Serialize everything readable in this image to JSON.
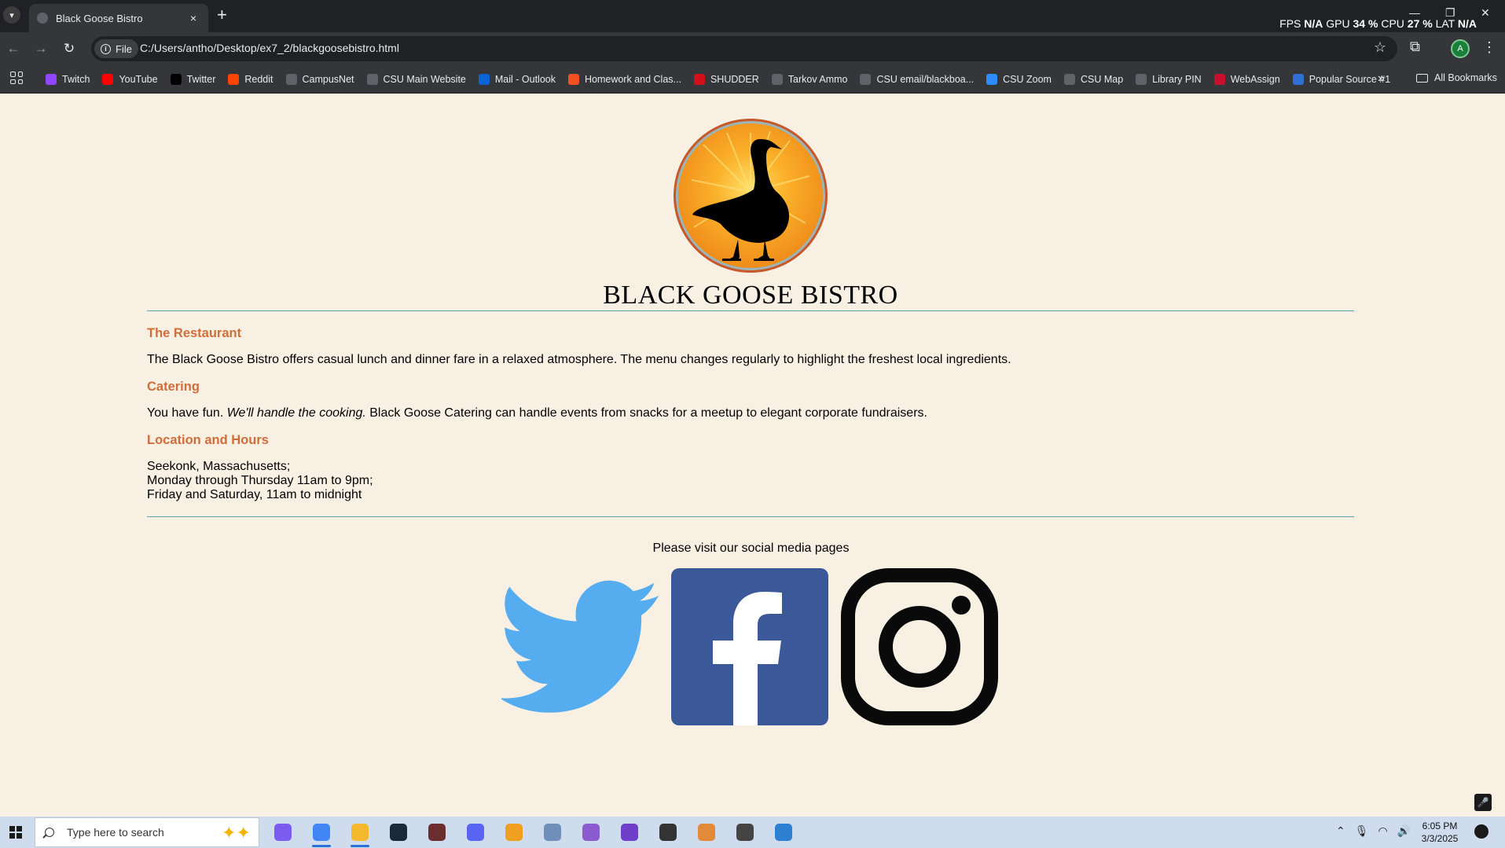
{
  "browser": {
    "tab_title": "Black Goose Bistro",
    "new_tab": "+",
    "tab_close": "×",
    "overlay": {
      "fps_label": "FPS",
      "fps_value": "N/A",
      "gpu_label": "GPU",
      "gpu_value": "34 %",
      "cpu_label": "CPU",
      "cpu_value": "27 %",
      "lat_label": "LAT",
      "lat_value": "N/A"
    },
    "chip_label": "File",
    "url": "C:/Users/antho/Desktop/ex7_2/blackgoosebistro.html",
    "profile_initial": "A",
    "bookmarks": [
      {
        "label": "Twitch",
        "icon": "twitch-icon",
        "color": "#9146ff"
      },
      {
        "label": "YouTube",
        "icon": "youtube-icon",
        "color": "#ff0000"
      },
      {
        "label": "Twitter",
        "icon": "x-icon",
        "color": "#000000"
      },
      {
        "label": "Reddit",
        "icon": "reddit-icon",
        "color": "#ff4500"
      },
      {
        "label": "CampusNet",
        "icon": "globe-icon",
        "color": "#5f6368"
      },
      {
        "label": "CSU Main Website",
        "icon": "csu-icon",
        "color": "#5f6368"
      },
      {
        "label": "Mail - Outlook",
        "icon": "outlook-icon",
        "color": "#0a64d6"
      },
      {
        "label": "Homework and Clas...",
        "icon": "microsoft-icon",
        "color": "#f25022"
      },
      {
        "label": "SHUDDER",
        "icon": "shudder-icon",
        "color": "#d1101a"
      },
      {
        "label": "Tarkov Ammo",
        "icon": "tarkov-icon",
        "color": "#5f6368"
      },
      {
        "label": "CSU email/blackboa...",
        "icon": "csu-icon",
        "color": "#5f6368"
      },
      {
        "label": "CSU Zoom",
        "icon": "zoom-icon",
        "color": "#2d8cff"
      },
      {
        "label": "CSU Map",
        "icon": "csu-icon",
        "color": "#5f6368"
      },
      {
        "label": "Library PIN",
        "icon": "csu-icon",
        "color": "#5f6368"
      },
      {
        "label": "WebAssign",
        "icon": "webassign-icon",
        "color": "#c8102e"
      },
      {
        "label": "Popular Source #1",
        "icon": "pt-icon",
        "color": "#2f6fd6"
      }
    ],
    "bookmarks_more": "»",
    "all_bookmarks": "All Bookmarks"
  },
  "page": {
    "title": "BLACK GOOSE BISTRO",
    "sections": {
      "restaurant_heading": "The Restaurant",
      "restaurant_text": "The Black Goose Bistro offers casual lunch and dinner fare in a relaxed atmosphere. The menu changes regularly to highlight the freshest local ingredients.",
      "catering_heading": "Catering",
      "catering_before": "You have fun. ",
      "catering_em": "We'll handle the cooking.",
      "catering_after": " Black Goose Catering can handle events from snacks for a meetup to elegant corporate fundraisers.",
      "location_heading": "Location and Hours",
      "location_line1": "Seekonk, Massachusetts;",
      "location_line2": "Monday through Thursday 11am to 9pm;",
      "location_line3": "Friday and Saturday, 11am to midnight"
    },
    "social_text": "Please visit our social media pages",
    "colors": {
      "background": "#f9f0e4",
      "heading": "#d06e3a",
      "rule": "#5ca4a9",
      "twitter": "#55acee",
      "facebook": "#3b5998",
      "instagram": "#0a0a0a"
    }
  },
  "taskbar": {
    "search_placeholder": "Type here to search",
    "apps": [
      "copilot-icon",
      "chrome-icon",
      "file-explorer-icon",
      "steam-icon",
      "game-icon",
      "discord-icon",
      "app-icon",
      "photos-icon",
      "visual-studio-icon",
      "github-desktop-icon",
      "unity-icon",
      "paint-icon",
      "game-icon",
      "notepad-icon"
    ],
    "time": "6:05 PM",
    "date": "3/3/2025"
  }
}
